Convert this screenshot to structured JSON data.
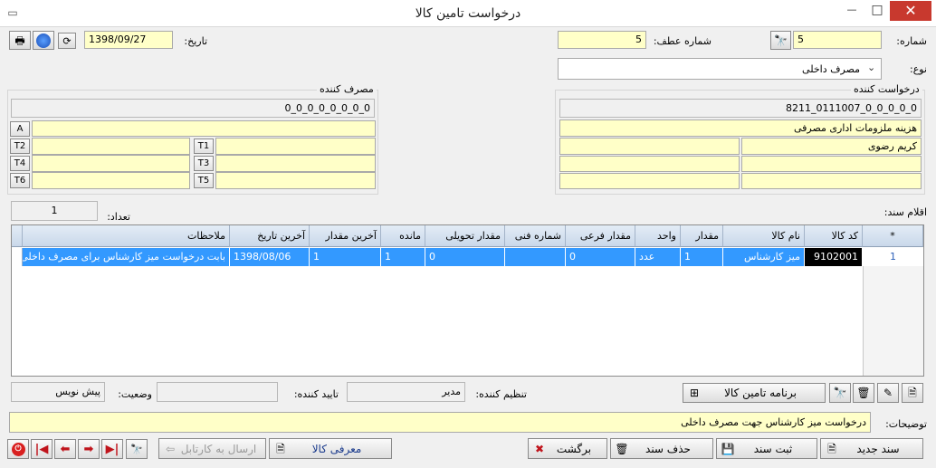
{
  "window": {
    "title": "درخواست تامین کالا",
    "restore_glyph": "▭",
    "min_glyph": "—",
    "max_glyph": "□",
    "close_glyph": "✕"
  },
  "header": {
    "number_label": "شماره:",
    "number_value": "5",
    "ref_label": "شماره عطف:",
    "ref_value": "5",
    "date_label": "تاریخ:",
    "date_value": "1398/09/27",
    "type_label": "نوع:",
    "type_value": "مصرف داخلی"
  },
  "requester": {
    "title": "درخواست کننده",
    "code": "8211_0111007_0_0_0_0_0",
    "account": "هزینه ملزومات اداری مصرفی",
    "person": "کریم رضوی"
  },
  "consumer": {
    "title": "مصرف کننده",
    "code": "0_0_0_0_0_0_0_0",
    "tags": [
      "A",
      "T1",
      "T2",
      "T3",
      "T4",
      "T5",
      "T6"
    ]
  },
  "items": {
    "label": "اقلام سند:",
    "count_label": "تعداد:",
    "count_value": "1",
    "columns": [
      "*",
      "کد کالا",
      "نام کالا",
      "مقدار",
      "واحد",
      "مقدار فرعی",
      "شماره فنی",
      "مقدار تحویلی",
      "مانده",
      "آخرین مقدار",
      "آخرین تاریخ",
      "ملاحظات"
    ],
    "rows": [
      {
        "row_no": "1",
        "code": "9102001",
        "name": "میز کارشناس",
        "qty": "1",
        "unit": "عدد",
        "sub_qty": "0",
        "tech_no": "",
        "delivered": "0",
        "remaining": "1",
        "last_qty": "1",
        "last_date": "1398/08/06",
        "notes": "بابت درخواست میز کارشناس برای مصرف داخلی"
      }
    ]
  },
  "status": {
    "creator_label": "تنظیم کننده:",
    "creator_value": "مدیر",
    "approver_label": "تایید کننده:",
    "approver_value": "",
    "state_label": "وضعیت:",
    "state_value": "پیش نویس",
    "program_button": "برنامه تامین کالا"
  },
  "description": {
    "label": "توضیحات:",
    "value": "درخواست میز کارشناس جهت مصرف داخلی"
  },
  "buttons": {
    "new": "سند جدید",
    "save": "ثبت سند",
    "delete": "حذف سند",
    "back": "برگشت",
    "introduce": "معرفی کالا",
    "send": "ارسال به کارتابل"
  },
  "icons": {
    "print": "printer-icon",
    "globe": "globe-icon",
    "refresh": "refresh-icon",
    "binoculars": "binoculars-icon",
    "new_doc": "new-document-icon",
    "save": "floppy-icon",
    "delete": "trash-icon",
    "back": "cancel-icon",
    "introduce": "introduce-icon",
    "send": "send-arrow-icon",
    "exit": "exit-icon"
  },
  "colors": {
    "field_yellow": "#ffffc8",
    "selection": "#3399ff",
    "grid_header": "#d4e1f0",
    "close_red": "#c8392e",
    "nav_red": "#c0141c"
  }
}
